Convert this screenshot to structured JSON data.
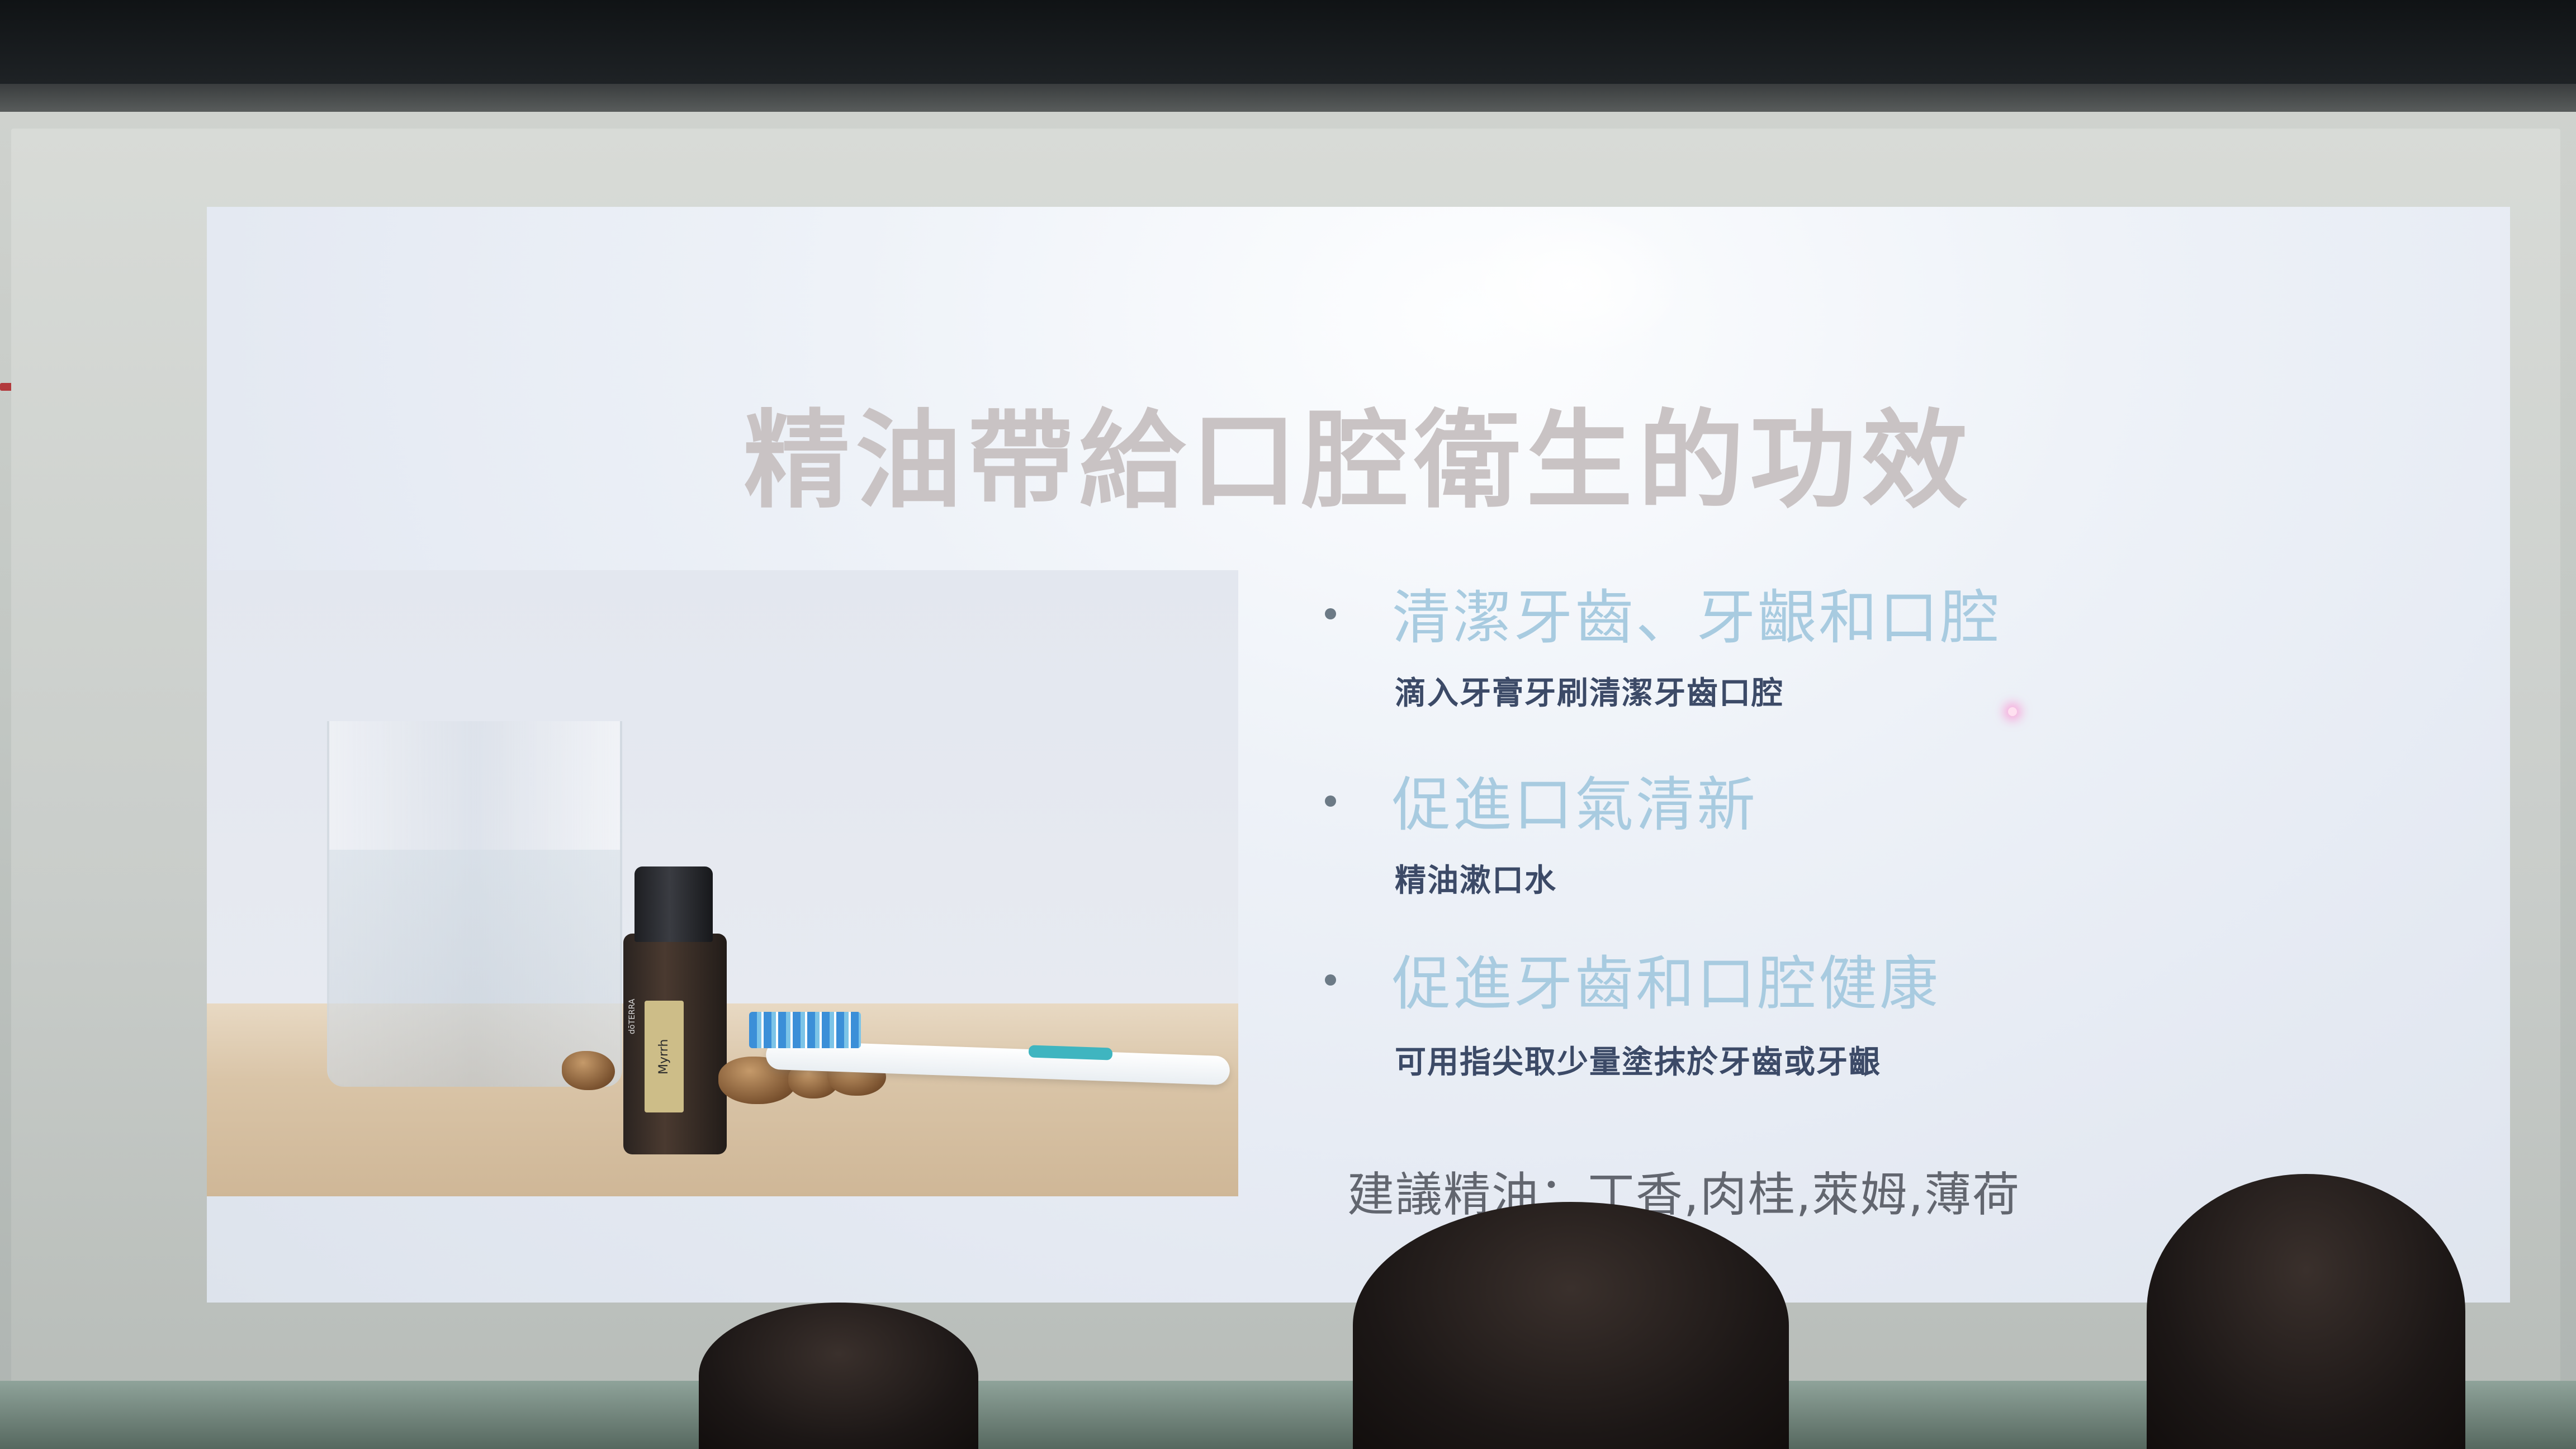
{
  "slide": {
    "title": "精油帶給口腔衛生的功效",
    "bullets": [
      {
        "heading": "清潔牙齒、牙齦和口腔",
        "detail": "滴入牙膏牙刷清潔牙齒口腔"
      },
      {
        "heading": "促進口氣清新",
        "detail": "精油漱口水"
      },
      {
        "heading": "促進牙齒和口腔健康",
        "detail": "可用指尖取少量塗抹於牙齒或牙齦"
      }
    ],
    "suggestion": "建議精油：丁香,肉桂,萊姆,薄荷",
    "photo": {
      "bottle_label": "Myrrh",
      "bottle_brand": "dōTERRA"
    }
  },
  "colors": {
    "title": "#c9c3c4",
    "bullet_heading": "#a8cbe0",
    "bullet_detail": "#3c4a67",
    "suggestion": "#62666f"
  }
}
